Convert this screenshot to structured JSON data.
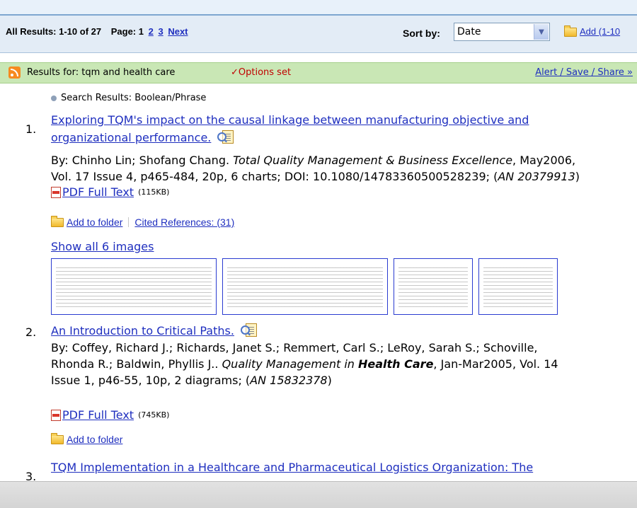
{
  "nav": {
    "results_label": "All Results: 1-10 of 27",
    "page_label": "Page: 1",
    "pages": [
      "2",
      "3"
    ],
    "next": "Next",
    "sort_label": "Sort by:",
    "sort_value": "Date",
    "add_link": "Add (1-10"
  },
  "bar": {
    "results_for": "Results for:  tqm and health care",
    "options_set": "✓Options set",
    "alert_link": "Alert / Save / Share »"
  },
  "search_mode": "Search Results: Boolean/Phrase",
  "results": [
    {
      "num": "1.",
      "title_line1": "Exploring TQM's impact on the causal linkage between manufacturing objective and",
      "title_line2": "organizational performance.",
      "by": "By: Chinho Lin; Shofang Chang.",
      "journal": "Total Quality Management & Business Excellence",
      "meta_rest": ", May2006,",
      "meta_line2_a": "Vol. 17 Issue 4, p465-484, 20p, 6 charts; DOI: 10.1080/14783360500528239; (",
      "an": "AN 20379913",
      "meta_line2_b": ")",
      "pdf_label": "PDF Full Text",
      "pdf_size": "(115KB)",
      "add_folder": "Add to folder",
      "cited": "Cited References: (31)",
      "show_images": "Show all 6 images"
    },
    {
      "num": "2.",
      "title_line1": "An Introduction to Critical Paths.",
      "by_line1": "By: Coffey, Richard J.; Richards, Janet S.; Remmert, Carl S.; LeRoy, Sarah S.; Schoville,",
      "by_line2a": "Rhonda R.; Baldwin, Phyllis J..",
      "journal_a": "Quality Management in",
      "journal_b": "Health Care",
      "meta_line2_rest": ", Jan-Mar2005, Vol. 14",
      "meta_line3a": "Issue 1, p46-55, 10p, 2 diagrams; (",
      "an": "AN 15832378",
      "meta_line3b": ")",
      "pdf_label": "PDF Full Text",
      "pdf_size": "(745KB)",
      "add_folder": "Add to folder"
    },
    {
      "num": "3.",
      "title_line1": "TQM Implementation in a Healthcare and Pharmaceutical Logistics Organization: The"
    }
  ]
}
